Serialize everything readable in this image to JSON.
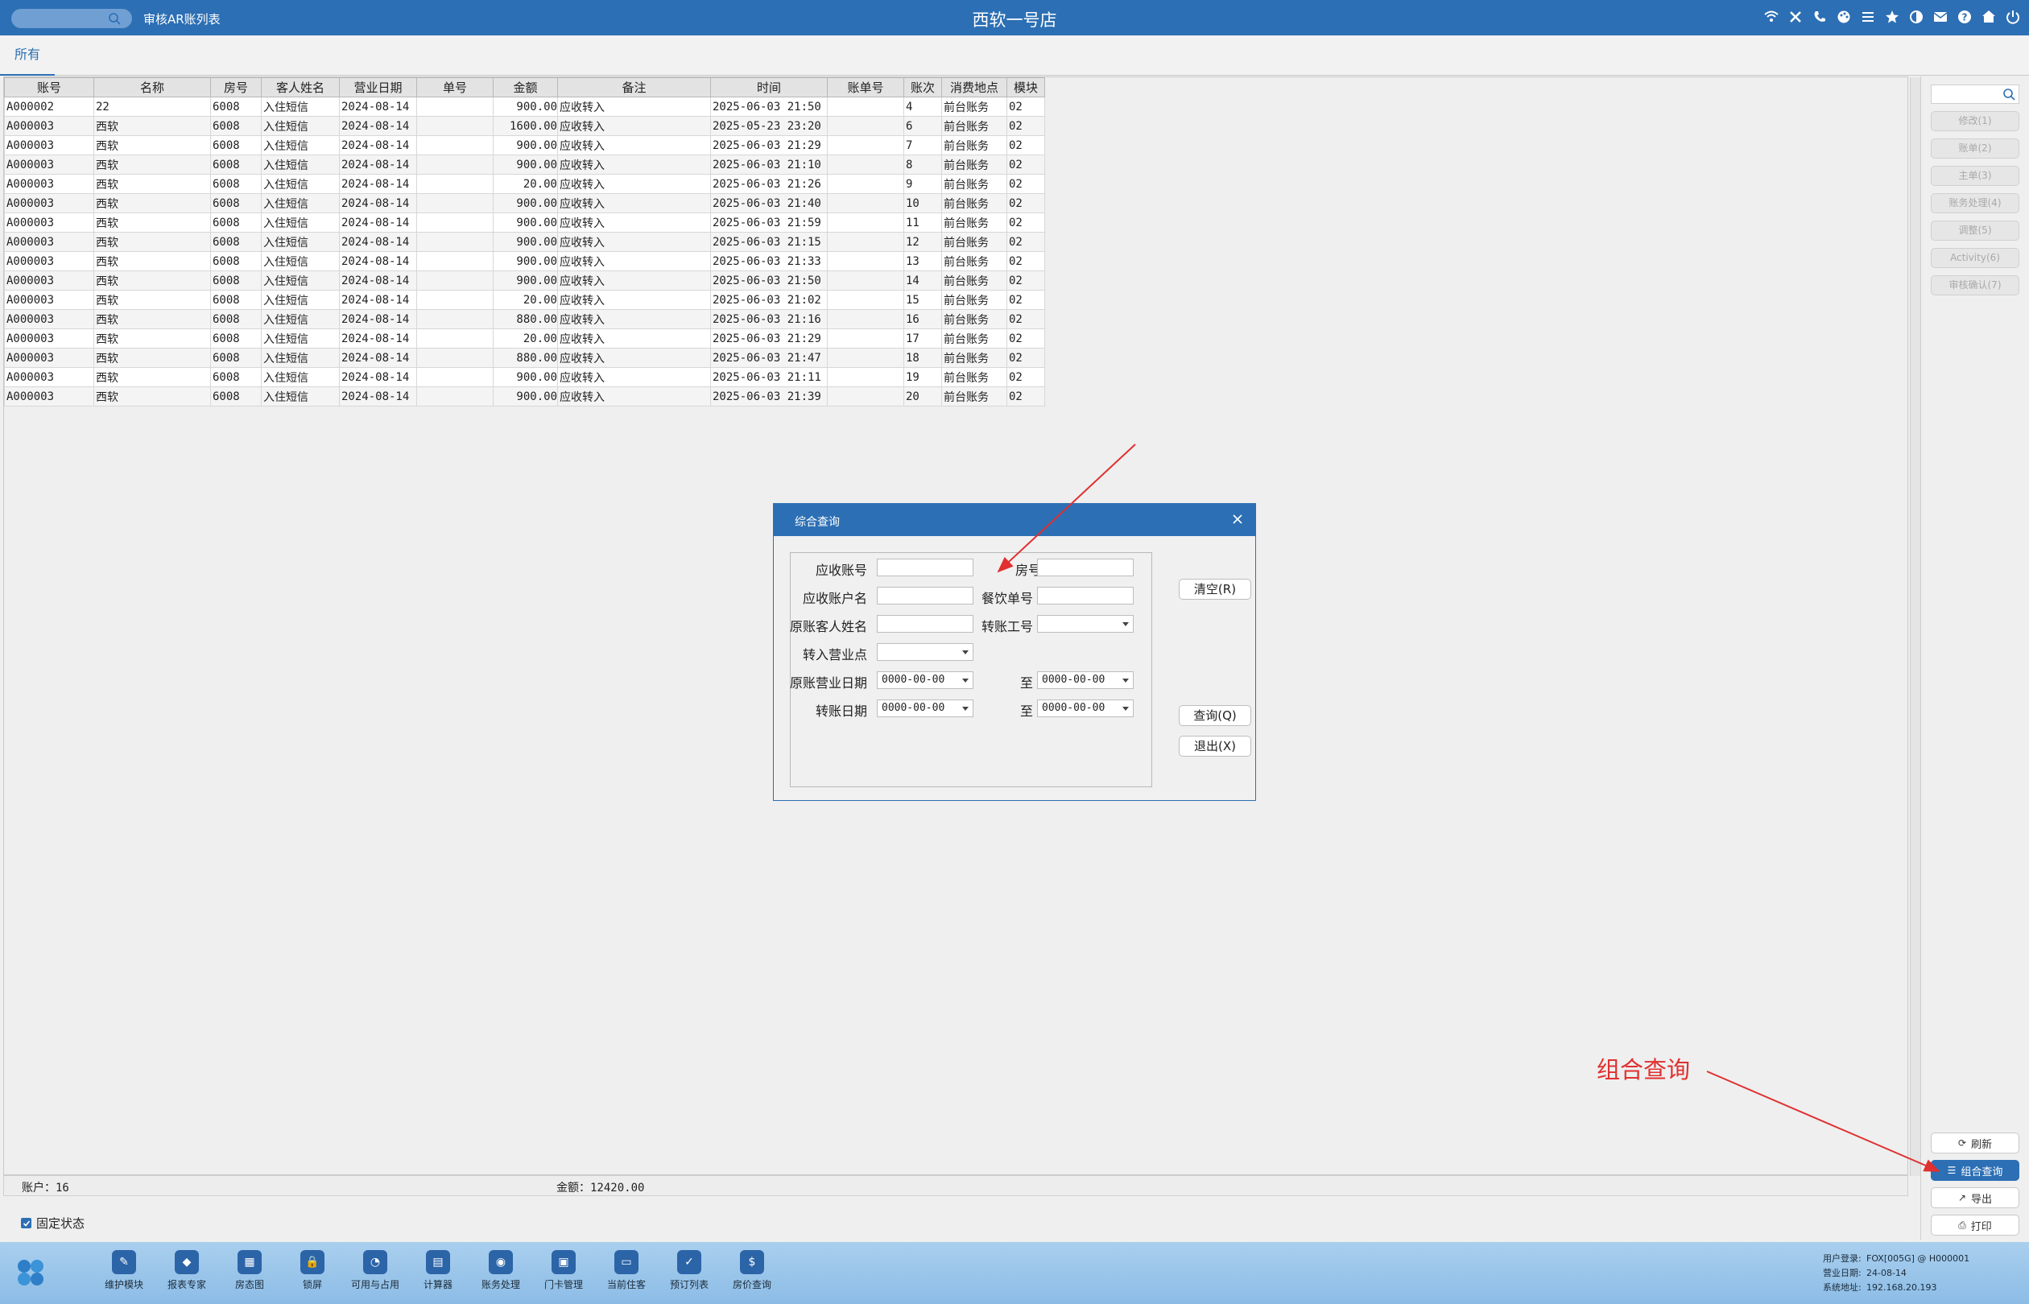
{
  "titlebar": {
    "window_caption": "审核AR账列表",
    "store_name": "西软一号店",
    "icons": [
      "wifi-icon",
      "tools-icon",
      "phone-icon",
      "palette-icon",
      "menu-icon",
      "star-icon",
      "contrast-icon",
      "mail-icon",
      "help-icon",
      "home-icon",
      "power-icon"
    ]
  },
  "tabs": {
    "all": "所有"
  },
  "chart_data": {
    "type": "table",
    "columns": [
      "账号",
      "名称",
      "房号",
      "客人姓名",
      "营业日期",
      "单号",
      "金额",
      "备注",
      "时间",
      "账单号",
      "账次",
      "消费地点",
      "模块"
    ],
    "rows": [
      [
        "A000002",
        "22",
        "6008",
        "入住短信",
        "2024-08-14",
        "",
        "900.00",
        "应收转入",
        "2025-06-03 21:50",
        "",
        "4",
        "前台账务",
        "02"
      ],
      [
        "A000003",
        "西软",
        "6008",
        "入住短信",
        "2024-08-14",
        "",
        "1600.00",
        "应收转入",
        "2025-05-23 23:20",
        "",
        "6",
        "前台账务",
        "02"
      ],
      [
        "A000003",
        "西软",
        "6008",
        "入住短信",
        "2024-08-14",
        "",
        "900.00",
        "应收转入",
        "2025-06-03 21:29",
        "",
        "7",
        "前台账务",
        "02"
      ],
      [
        "A000003",
        "西软",
        "6008",
        "入住短信",
        "2024-08-14",
        "",
        "900.00",
        "应收转入",
        "2025-06-03 21:10",
        "",
        "8",
        "前台账务",
        "02"
      ],
      [
        "A000003",
        "西软",
        "6008",
        "入住短信",
        "2024-08-14",
        "",
        "20.00",
        "应收转入",
        "2025-06-03 21:26",
        "",
        "9",
        "前台账务",
        "02"
      ],
      [
        "A000003",
        "西软",
        "6008",
        "入住短信",
        "2024-08-14",
        "",
        "900.00",
        "应收转入",
        "2025-06-03 21:40",
        "",
        "10",
        "前台账务",
        "02"
      ],
      [
        "A000003",
        "西软",
        "6008",
        "入住短信",
        "2024-08-14",
        "",
        "900.00",
        "应收转入",
        "2025-06-03 21:59",
        "",
        "11",
        "前台账务",
        "02"
      ],
      [
        "A000003",
        "西软",
        "6008",
        "入住短信",
        "2024-08-14",
        "",
        "900.00",
        "应收转入",
        "2025-06-03 21:15",
        "",
        "12",
        "前台账务",
        "02"
      ],
      [
        "A000003",
        "西软",
        "6008",
        "入住短信",
        "2024-08-14",
        "",
        "900.00",
        "应收转入",
        "2025-06-03 21:33",
        "",
        "13",
        "前台账务",
        "02"
      ],
      [
        "A000003",
        "西软",
        "6008",
        "入住短信",
        "2024-08-14",
        "",
        "900.00",
        "应收转入",
        "2025-06-03 21:50",
        "",
        "14",
        "前台账务",
        "02"
      ],
      [
        "A000003",
        "西软",
        "6008",
        "入住短信",
        "2024-08-14",
        "",
        "20.00",
        "应收转入",
        "2025-06-03 21:02",
        "",
        "15",
        "前台账务",
        "02"
      ],
      [
        "A000003",
        "西软",
        "6008",
        "入住短信",
        "2024-08-14",
        "",
        "880.00",
        "应收转入",
        "2025-06-03 21:16",
        "",
        "16",
        "前台账务",
        "02"
      ],
      [
        "A000003",
        "西软",
        "6008",
        "入住短信",
        "2024-08-14",
        "",
        "20.00",
        "应收转入",
        "2025-06-03 21:29",
        "",
        "17",
        "前台账务",
        "02"
      ],
      [
        "A000003",
        "西软",
        "6008",
        "入住短信",
        "2024-08-14",
        "",
        "880.00",
        "应收转入",
        "2025-06-03 21:47",
        "",
        "18",
        "前台账务",
        "02"
      ],
      [
        "A000003",
        "西软",
        "6008",
        "入住短信",
        "2024-08-14",
        "",
        "900.00",
        "应收转入",
        "2025-06-03 21:11",
        "",
        "19",
        "前台账务",
        "02"
      ],
      [
        "A000003",
        "西软",
        "6008",
        "入住短信",
        "2024-08-14",
        "",
        "900.00",
        "应收转入",
        "2025-06-03 21:39",
        "",
        "20",
        "前台账务",
        "02"
      ]
    ]
  },
  "summary": {
    "accounts": "账户：16",
    "amount": "金额：12420.00"
  },
  "fixed_state": "固定状态",
  "side_panel": {
    "disabled_buttons": [
      "修改(1)",
      "账单(2)",
      "主单(3)",
      "账务处理(4)",
      "调整(5)",
      "Activity(6)",
      "审核确认(7)"
    ],
    "refresh": "刷新",
    "combined_query": "组合查询",
    "export": "导出",
    "print": "打印"
  },
  "dialog": {
    "title": "综合查询",
    "labels": {
      "ar_account": "应收账号",
      "room_no": "房号",
      "ar_account_name": "应收账户名",
      "fnb_bill_no": "餐饮单号",
      "orig_guest_name": "原账客人姓名",
      "transfer_staff_no": "转账工号",
      "transfer_outlet": "转入营业点",
      "orig_business_date": "原账营业日期",
      "to": "至",
      "transfer_date": "转账日期"
    },
    "date_default": "0000-00-00",
    "buttons": {
      "clear": "清空(R)",
      "query": "查询(Q)",
      "exit": "退出(X)"
    }
  },
  "annotation": {
    "label": "组合查询",
    "color": "#e03030"
  },
  "taskbar": {
    "items": [
      "维护模块",
      "报表专家",
      "房态图",
      "锁屏",
      "可用与占用",
      "计算器",
      "账务处理",
      "门卡管理",
      "当前住客",
      "预订列表",
      "房价查询"
    ]
  },
  "sys_info": {
    "user_label": "用户登录:",
    "user_value": "FOX[005G] @ H000001",
    "date_label": "营业日期:",
    "date_value": "24-08-14",
    "addr_label": "系统地址:",
    "addr_value": "192.168.20.193"
  },
  "colors": {
    "accent": "#2c6fb4",
    "annotation": "#e03030"
  }
}
